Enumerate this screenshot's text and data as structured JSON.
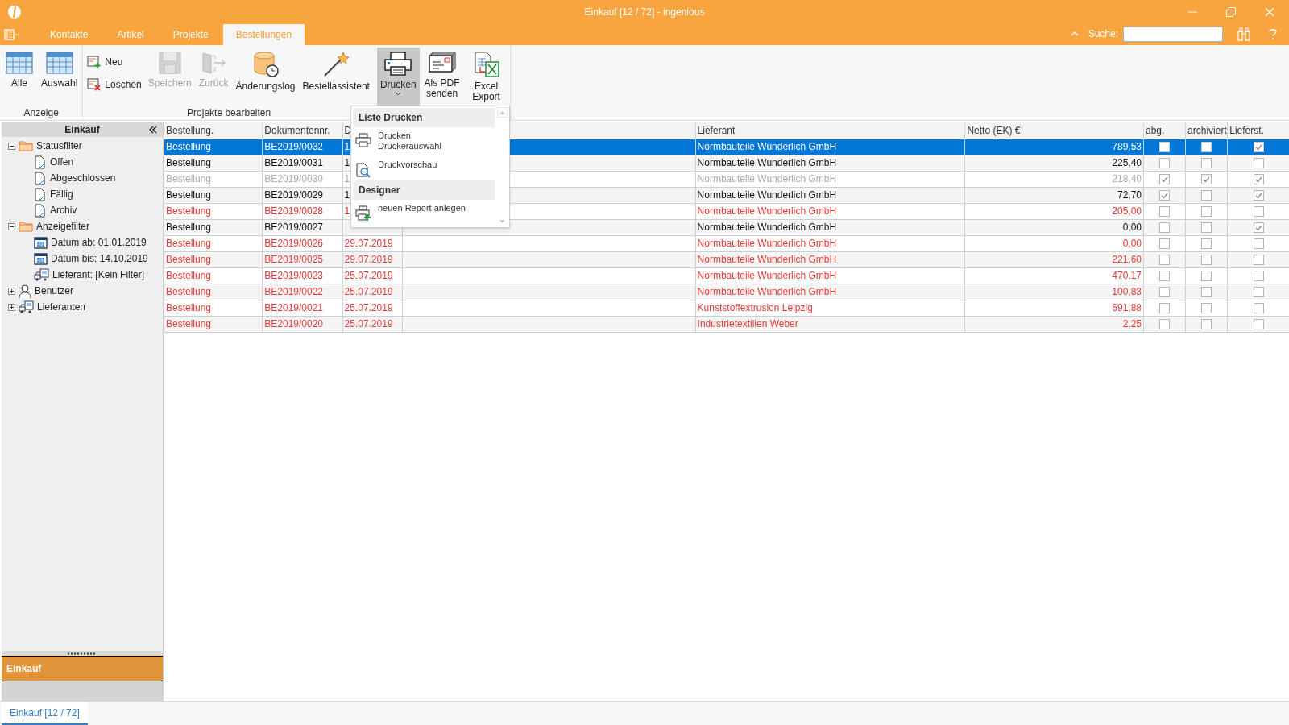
{
  "window": {
    "title": "Einkauf [12 / 72] - ingenious"
  },
  "tabs": [
    {
      "label": "Kontakte",
      "selected": false
    },
    {
      "label": "Artikel",
      "selected": false
    },
    {
      "label": "Projekte",
      "selected": false
    },
    {
      "label": "Bestellungen",
      "selected": true
    }
  ],
  "search": {
    "label": "Suche:"
  },
  "ribbon": [
    {
      "label": "Anzeige",
      "buttons": [
        {
          "kind": "large",
          "label": "Alle",
          "disabled": false,
          "selected": false
        },
        {
          "kind": "large",
          "label": "Auswahl",
          "disabled": false,
          "selected": false
        }
      ]
    },
    {
      "label": "Projekte bearbeiten",
      "buttons": [
        {
          "kind": "stack",
          "items": [
            {
              "label": "Neu"
            },
            {
              "label": "Löschen"
            }
          ]
        },
        {
          "kind": "large",
          "label": "Speichern",
          "disabled": true,
          "selected": false
        },
        {
          "kind": "large",
          "label": "Zurück",
          "disabled": true,
          "selected": false
        },
        {
          "kind": "large",
          "label": "Änderungslog",
          "disabled": false,
          "selected": false
        },
        {
          "kind": "large",
          "label": "Bestellassistent",
          "disabled": false,
          "selected": false
        }
      ]
    },
    {
      "buttons": [
        {
          "kind": "large",
          "label": "Drucken",
          "disabled": false,
          "selected": true,
          "dropdown": true
        },
        {
          "kind": "large",
          "label": "Als PDF senden",
          "disabled": false,
          "selected": false
        },
        {
          "kind": "large",
          "label": "Excel Export",
          "disabled": false,
          "selected": false
        }
      ]
    }
  ],
  "print_menu": [
    {
      "kind": "header",
      "label": "Liste Drucken"
    },
    {
      "kind": "item",
      "label": "Drucken",
      "sublabel": "Druckerauswahl"
    },
    {
      "kind": "item",
      "label": "Druckvorschau"
    },
    {
      "kind": "header",
      "label": "Designer"
    },
    {
      "kind": "item",
      "label": "neuen Report anlegen"
    }
  ],
  "sidebar": {
    "title": "Einkauf",
    "section": "Einkauf",
    "tree": [
      {
        "kind": "folder",
        "label": "Statusfilter",
        "expanded": true,
        "children": [
          {
            "kind": "doc",
            "label": "Offen"
          },
          {
            "kind": "doc",
            "label": "Abgeschlossen"
          },
          {
            "kind": "doc",
            "label": "Fällig"
          },
          {
            "kind": "doc",
            "label": "Archiv"
          }
        ]
      },
      {
        "kind": "folder",
        "label": "Anzeigefilter",
        "expanded": true,
        "children": [
          {
            "kind": "date",
            "label": "Datum ab: 01.01.2019"
          },
          {
            "kind": "date",
            "label": "Datum bis: 14.10.2019"
          },
          {
            "kind": "truck",
            "label": "Lieferant: [Kein Filter]"
          }
        ]
      },
      {
        "kind": "user",
        "label": "Benutzer",
        "expanded": false
      },
      {
        "kind": "truck",
        "label": "Lieferanten",
        "expanded": false
      }
    ]
  },
  "table": {
    "columns": [
      "Bestellung.",
      "Dokumentennr.",
      "D",
      "Lieferant",
      "Netto (EK) €",
      "abg.",
      "archiviert",
      "Lieferst."
    ],
    "rows": [
      {
        "kind": "normal",
        "selected": true,
        "type": "Bestellung",
        "number": "BE2019/0032",
        "date": "1",
        "supplier": "Normbauteile Wunderlich GmbH",
        "net": "789,53",
        "abg": false,
        "archiviert": false,
        "lieferst": true
      },
      {
        "kind": "normal",
        "selected": false,
        "type": "Bestellung",
        "number": "BE2019/0031",
        "date": "1",
        "supplier": "Normbauteile Wunderlich GmbH",
        "net": "225,40",
        "abg": false,
        "archiviert": false,
        "lieferst": false
      },
      {
        "kind": "archived",
        "selected": false,
        "type": "Bestellung",
        "number": "BE2019/0030",
        "date": "1",
        "supplier": "Normbauteile Wunderlich GmbH",
        "net": "218,40",
        "abg": true,
        "archiviert": true,
        "lieferst": true
      },
      {
        "kind": "normal",
        "selected": false,
        "type": "Bestellung",
        "number": "BE2019/0029",
        "date": "1",
        "supplier": "Normbauteile Wunderlich GmbH",
        "net": "72,70",
        "abg": true,
        "archiviert": false,
        "lieferst": true
      },
      {
        "kind": "overdue",
        "selected": false,
        "type": "Bestellung",
        "number": "BE2019/0028",
        "date": "1",
        "supplier": "Normbauteile Wunderlich GmbH",
        "net": "205,00",
        "abg": false,
        "archiviert": false,
        "lieferst": false
      },
      {
        "kind": "normal",
        "selected": false,
        "type": "Bestellung",
        "number": "BE2019/0027",
        "supplier": "Normbauteile Wunderlich GmbH",
        "net": "0,00",
        "abg": false,
        "archiviert": false,
        "lieferst": true
      },
      {
        "kind": "overdue",
        "selected": false,
        "type": "Bestellung",
        "number": "BE2019/0026",
        "date": "29.07.2019",
        "supplier": "Normbauteile Wunderlich GmbH",
        "net": "0,00",
        "abg": false,
        "archiviert": false,
        "lieferst": false
      },
      {
        "kind": "overdue",
        "selected": false,
        "type": "Bestellung",
        "number": "BE2019/0025",
        "date": "29.07.2019",
        "supplier": "Normbauteile Wunderlich GmbH",
        "net": "221,60",
        "abg": false,
        "archiviert": false,
        "lieferst": false
      },
      {
        "kind": "overdue",
        "selected": false,
        "type": "Bestellung",
        "number": "BE2019/0023",
        "date": "25.07.2019",
        "supplier": "Normbauteile Wunderlich GmbH",
        "net": "470,17",
        "abg": false,
        "archiviert": false,
        "lieferst": false
      },
      {
        "kind": "overdue",
        "selected": false,
        "type": "Bestellung",
        "number": "BE2019/0022",
        "date": "25.07.2019",
        "supplier": "Normbauteile Wunderlich GmbH",
        "net": "100,83",
        "abg": false,
        "archiviert": false,
        "lieferst": false
      },
      {
        "kind": "overdue",
        "selected": false,
        "type": "Bestellung",
        "number": "BE2019/0021",
        "date": "25.07.2019",
        "supplier": "Kunststoffextrusion Leipzig",
        "net": "691,88",
        "abg": false,
        "archiviert": false,
        "lieferst": false
      },
      {
        "kind": "overdue",
        "selected": false,
        "type": "Bestellung",
        "number": "BE2019/0020",
        "date": "25.07.2019",
        "supplier": "Industrietextilien Weber",
        "net": "2,25",
        "abg": false,
        "archiviert": false,
        "lieferst": false
      }
    ]
  },
  "document_tabs": [
    {
      "label": "Einkauf [12 / 72]",
      "selected": true
    }
  ]
}
